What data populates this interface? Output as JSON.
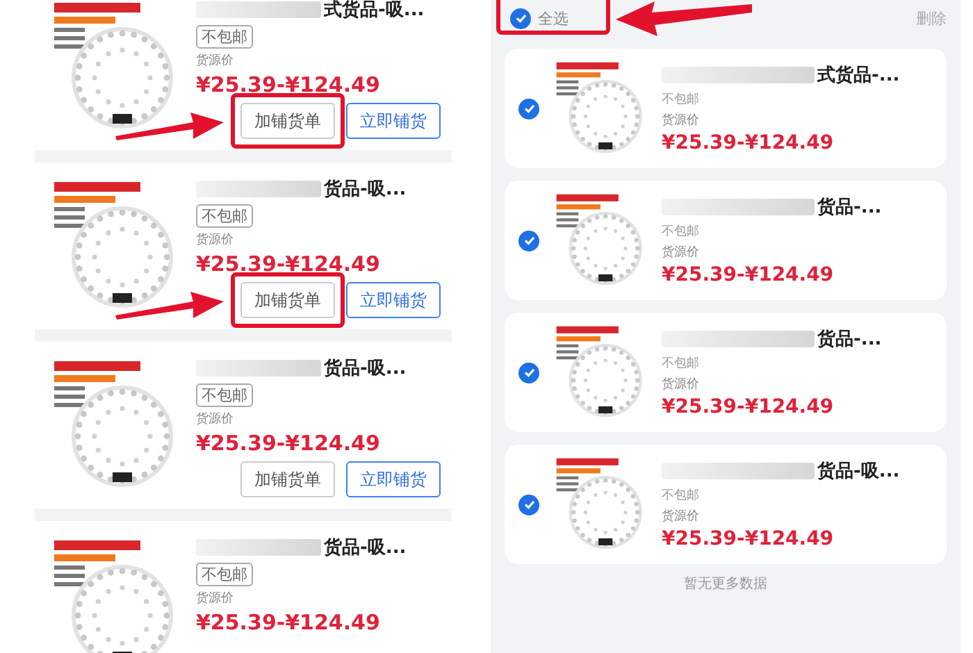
{
  "left_list": {
    "items": [
      {
        "title": "式货品-吸...",
        "shipping_tag": "不包邮",
        "price_label": "货源价",
        "price": "¥25.39-¥124.49",
        "buttons": [
          {
            "label": "加铺货单",
            "kind": "secondary",
            "highlighted": true
          },
          {
            "label": "立即铺货",
            "kind": "primary",
            "highlighted": false
          }
        ]
      },
      {
        "title": "货品-吸...",
        "shipping_tag": "不包邮",
        "price_label": "货源价",
        "price": "¥25.39-¥124.49",
        "buttons": [
          {
            "label": "加铺货单",
            "kind": "secondary",
            "highlighted": true
          },
          {
            "label": "立即铺货",
            "kind": "primary",
            "highlighted": false
          }
        ]
      },
      {
        "title": "货品-吸...",
        "shipping_tag": "不包邮",
        "price_label": "货源价",
        "price": "¥25.39-¥124.49",
        "buttons": [
          {
            "label": "加铺货单",
            "kind": "secondary",
            "highlighted": false
          },
          {
            "label": "立即铺货",
            "kind": "primary",
            "highlighted": false
          }
        ]
      },
      {
        "title": "货品-吸...",
        "shipping_tag": "不包邮",
        "price_label": "货源价",
        "price": "¥25.39-¥124.49"
      }
    ]
  },
  "right_list": {
    "select_all": {
      "label": "全选",
      "checked": true,
      "highlighted": true
    },
    "delete_button": "删除",
    "items": [
      {
        "selected": true,
        "title": "式货品-...",
        "shipping_tag": "不包邮",
        "price_label": "货源价",
        "price": "¥25.39-¥124.49"
      },
      {
        "selected": true,
        "title": "货品-...",
        "shipping_tag": "不包邮",
        "price_label": "货源价",
        "price": "¥25.39-¥124.49"
      },
      {
        "selected": true,
        "title": "货品-...",
        "shipping_tag": "不包邮",
        "price_label": "货源价",
        "price": "¥25.39-¥124.49"
      },
      {
        "selected": true,
        "title": "货品-吸...",
        "shipping_tag": "不包邮",
        "price_label": "货源价",
        "price": "¥25.39-¥124.49"
      }
    ],
    "end_note": "暂无更多数据"
  }
}
